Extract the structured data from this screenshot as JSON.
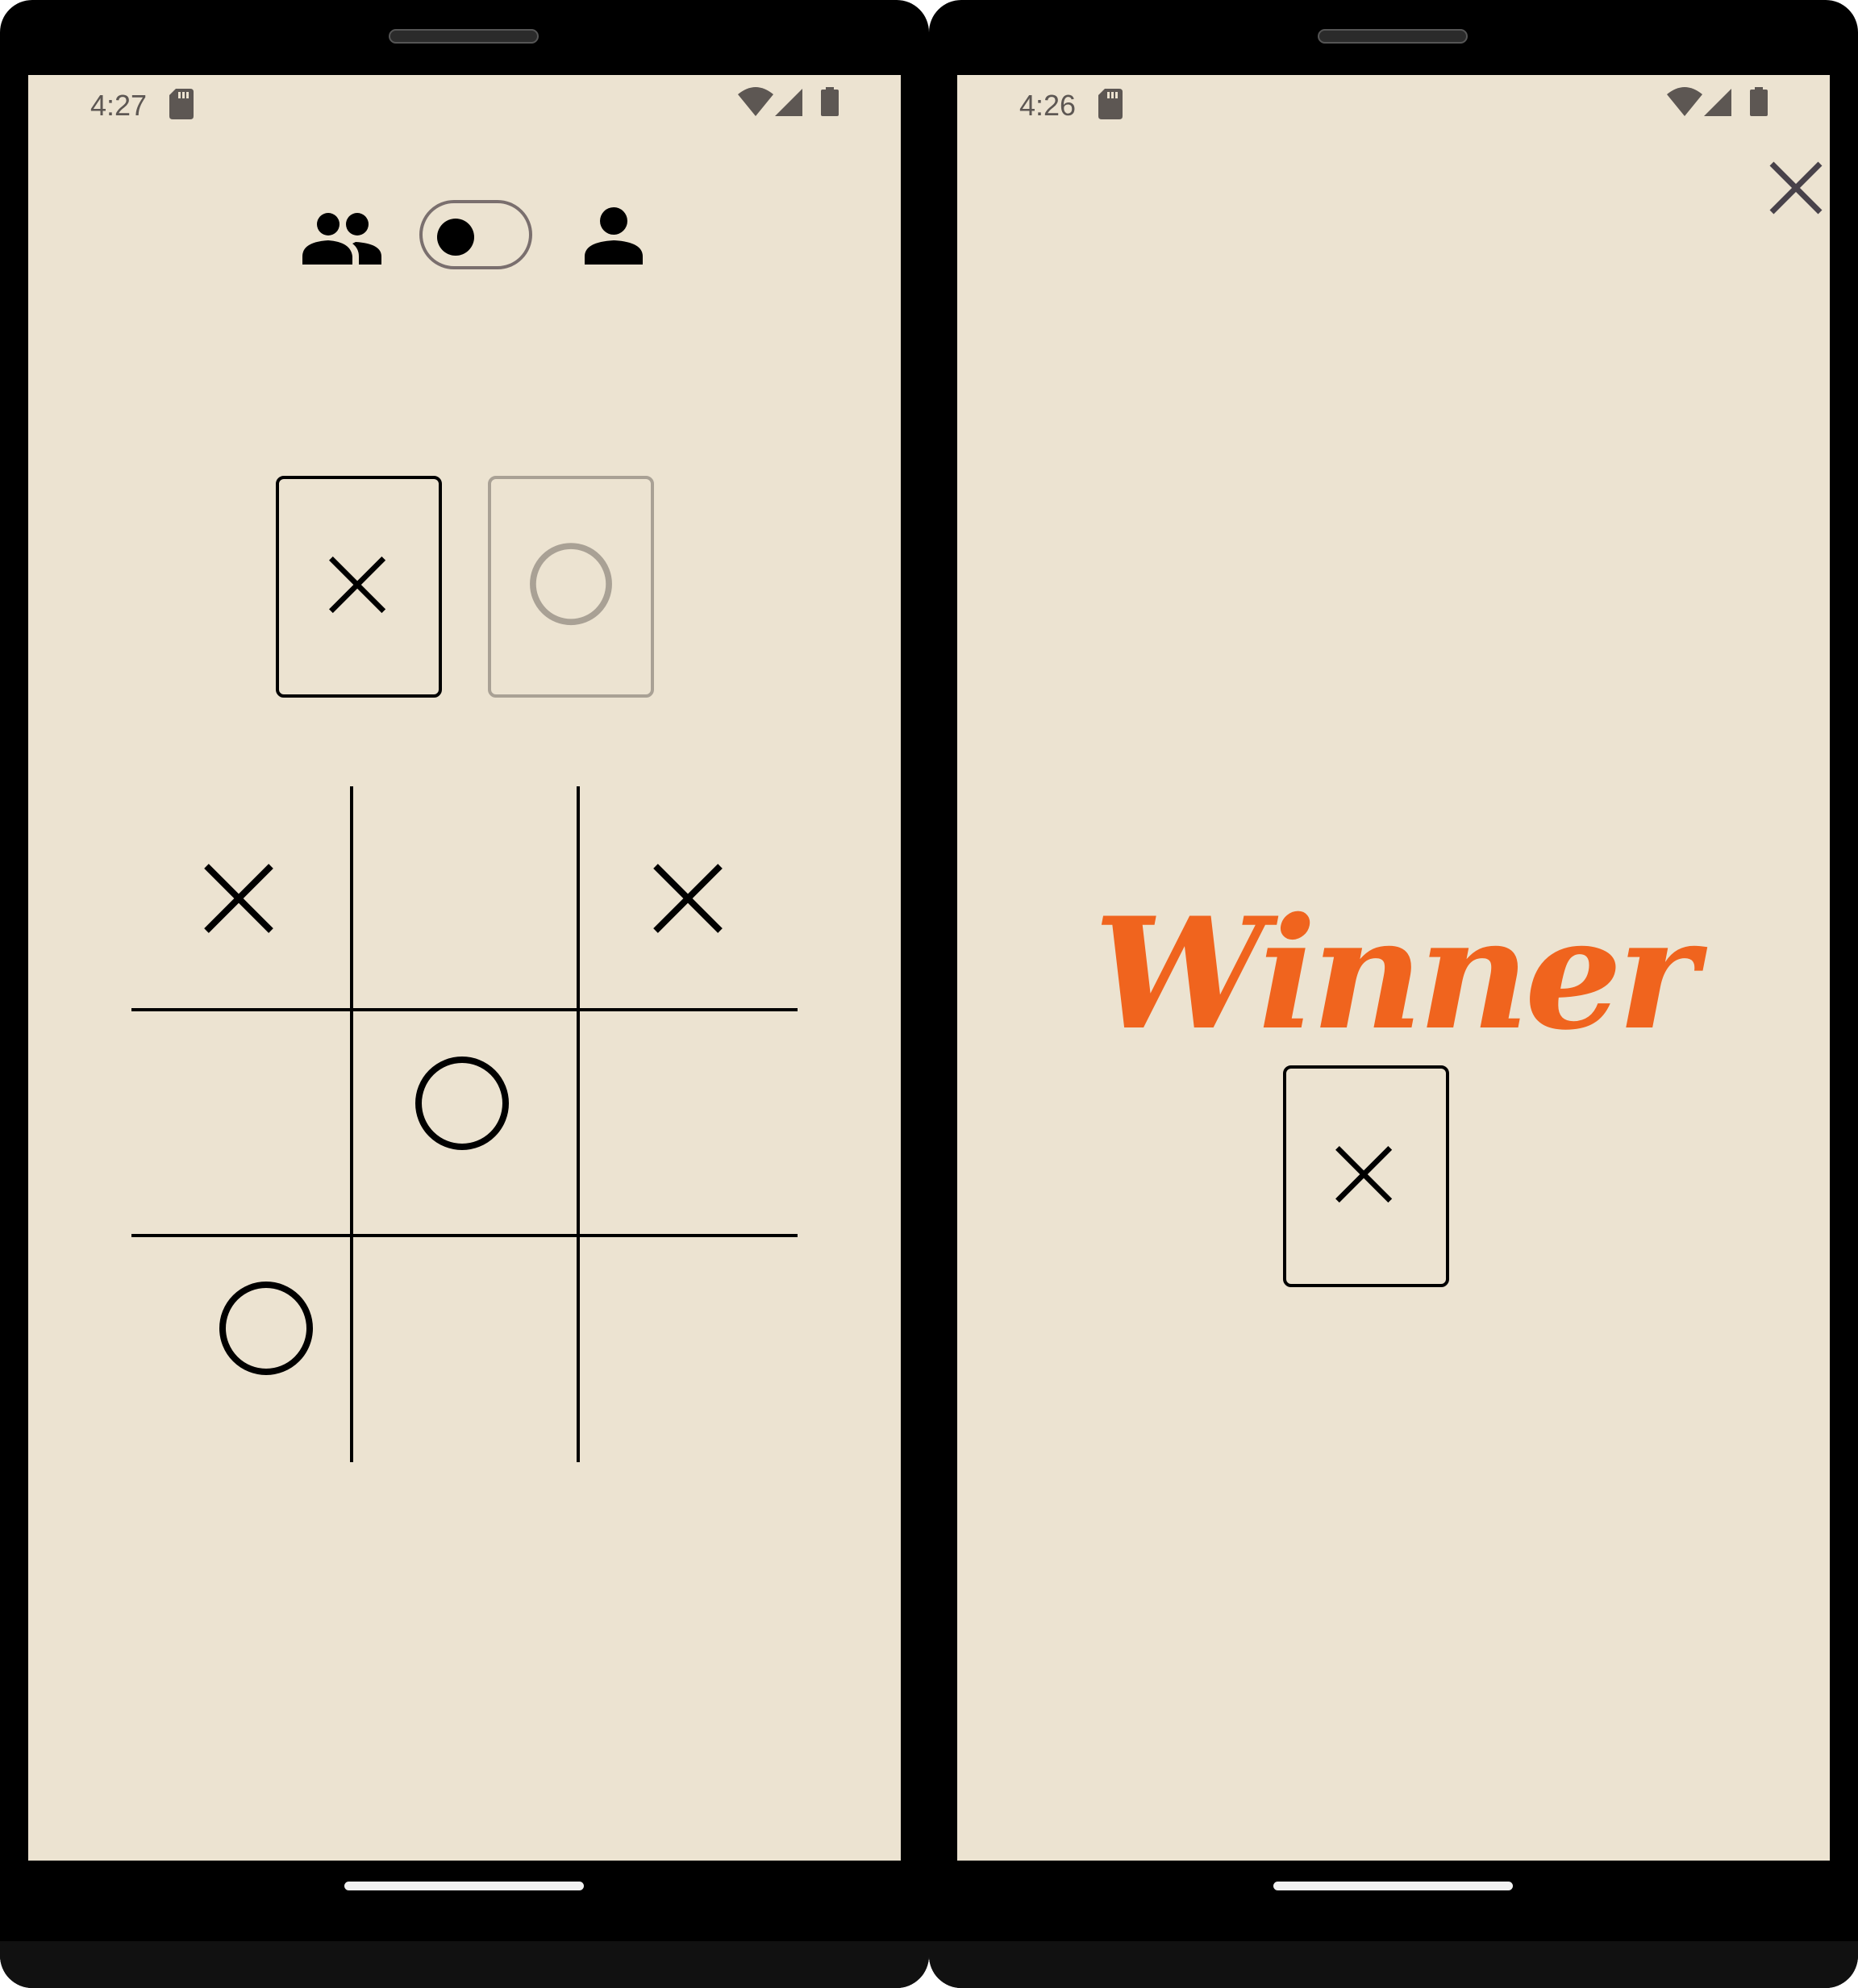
{
  "colors": {
    "screen_background": "#ece3d1",
    "mark": "#000000",
    "inactive_mark": "#a9a195",
    "status_text": "#5d5753",
    "switch_border": "#7a6f6e",
    "winner_text": "#f0641e",
    "close_icon": "#48424a"
  },
  "left_screen": {
    "status_bar": {
      "time": "4:27",
      "icons": [
        "sd-card-icon",
        "wifi-icon",
        "cellular-signal-icon",
        "battery-icon"
      ]
    },
    "mode_toggle": {
      "left_icon": "people-icon",
      "right_icon": "person-icon",
      "switch_on": false
    },
    "player_cards": [
      {
        "symbol": "X",
        "active": true
      },
      {
        "symbol": "O",
        "active": false
      }
    ],
    "board": [
      "X",
      "",
      "X",
      "",
      "O",
      "",
      "O",
      "",
      ""
    ]
  },
  "right_screen": {
    "status_bar": {
      "time": "4:26",
      "icons": [
        "sd-card-icon",
        "wifi-icon",
        "cellular-signal-icon",
        "battery-icon"
      ]
    },
    "close_icon": "close-icon",
    "winner_title": "Winner",
    "winner_symbol": "X"
  }
}
